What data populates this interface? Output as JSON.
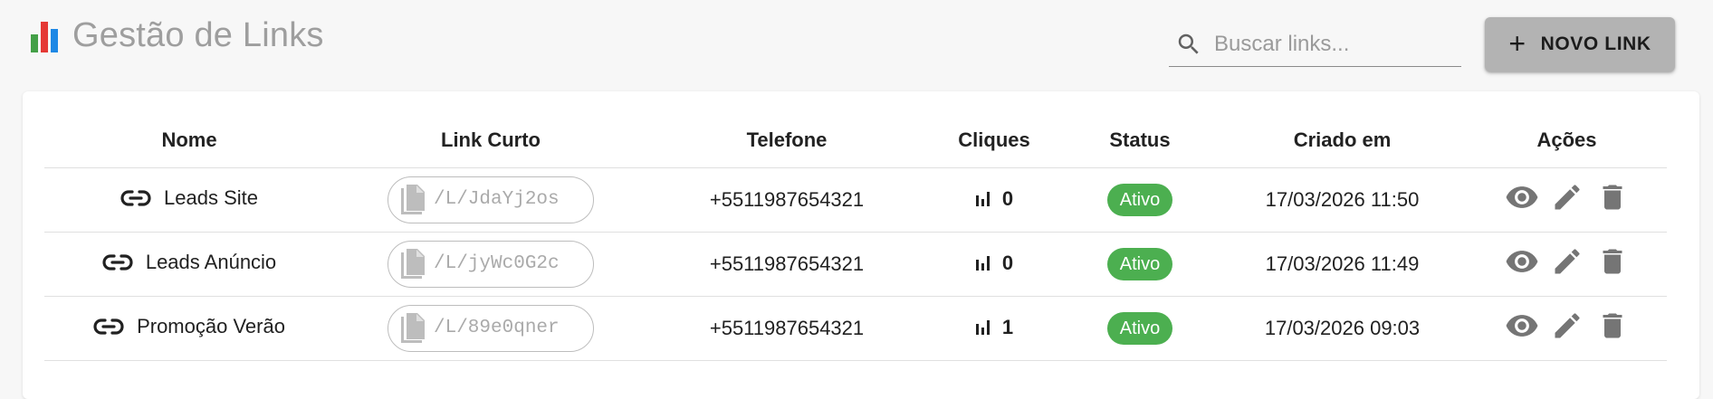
{
  "header": {
    "title": "Gestão de Links",
    "title_icon": "bar-chart-icon",
    "search_placeholder": "Buscar links...",
    "new_button_label": "NOVO LINK"
  },
  "table": {
    "columns": [
      "Nome",
      "Link Curto",
      "Telefone",
      "Cliques",
      "Status",
      "Criado em",
      "Ações"
    ],
    "rows": [
      {
        "name": "Leads Site",
        "short_link": "/L/JdaYj2os",
        "phone": "+5511987654321",
        "clicks": "0",
        "status": "Ativo",
        "created": "17/03/2026 11:50"
      },
      {
        "name": "Leads Anúncio",
        "short_link": "/L/jyWc0G2c",
        "phone": "+5511987654321",
        "clicks": "0",
        "status": "Ativo",
        "created": "17/03/2026 11:49"
      },
      {
        "name": "Promoção Verão",
        "short_link": "/L/89e0qner",
        "phone": "+5511987654321",
        "clicks": "1",
        "status": "Ativo",
        "created": "17/03/2026 09:03"
      }
    ]
  },
  "colors": {
    "status_active": "#4caf50",
    "button_bg": "#b3b3b3",
    "icon_gray": "#757575"
  }
}
